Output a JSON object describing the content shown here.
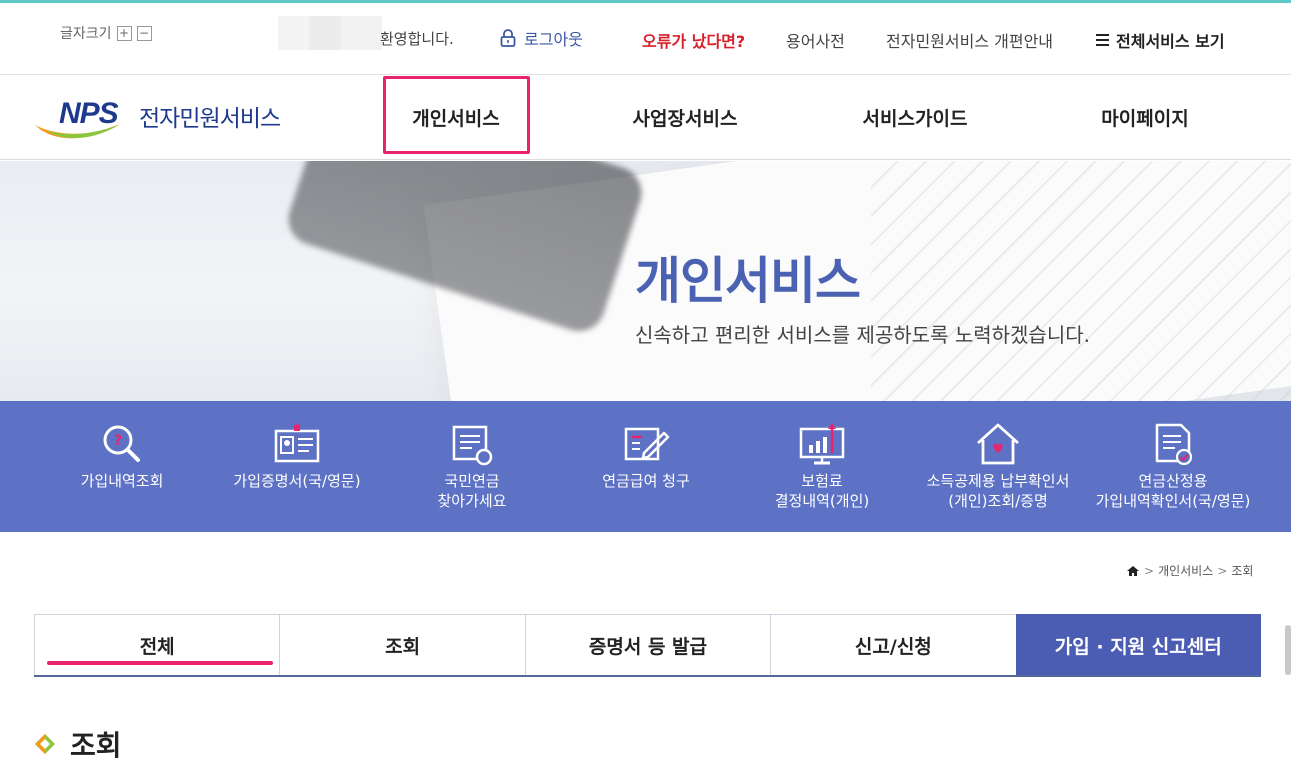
{
  "utility": {
    "font_size_label": "글자크기",
    "font_plus": "+",
    "font_minus": "−",
    "welcome": "환영합니다.",
    "logout": "로그아웃",
    "error_report": "오류가 났다면?",
    "dictionary": "용어사전",
    "renewal_guide": "전자민원서비스 개편안내",
    "all_services": "전체서비스 보기"
  },
  "logo": {
    "mark": "NPS",
    "name": "전자민원서비스"
  },
  "gnb": {
    "items": [
      "개인서비스",
      "사업장서비스",
      "서비스가이드",
      "마이페이지"
    ]
  },
  "hero": {
    "title": "개인서비스",
    "subtitle": "신속하고 편리한 서비스를 제공하도록 노력하겠습니다."
  },
  "quick_menu": [
    {
      "label": "가입내역조회",
      "icon": "search-question-icon"
    },
    {
      "label": "가입증명서(국/영문)",
      "icon": "certificate-id-icon"
    },
    {
      "label": "국민연금\n찾아가세요",
      "icon": "document-coin-icon"
    },
    {
      "label": "연금급여 청구",
      "icon": "form-pen-icon"
    },
    {
      "label": "보험료\n결정내역(개인)",
      "icon": "monitor-chart-icon"
    },
    {
      "label": "소득공제용 납부확인서\n(개인)조회/증명",
      "icon": "house-heart-icon"
    },
    {
      "label": "연금산정용\n가입내역확인서(국/영문)",
      "icon": "document-check-icon"
    }
  ],
  "breadcrumb": {
    "level1": "개인서비스",
    "level2": "조회"
  },
  "tabs": [
    "전체",
    "조회",
    "증명서 등 발급",
    "신고/신청",
    "가입 · 지원 신고센터"
  ],
  "section": {
    "title": "조회"
  },
  "colors": {
    "accent_top": "#5ec8c4",
    "brand_blue": "#1d3a8e",
    "hero_title": "#4b62b3",
    "quick_bg": "#5d72c5",
    "highlight_pink": "#e8246e",
    "error_red": "#d8202a",
    "tab_dark": "#4b5db3"
  }
}
